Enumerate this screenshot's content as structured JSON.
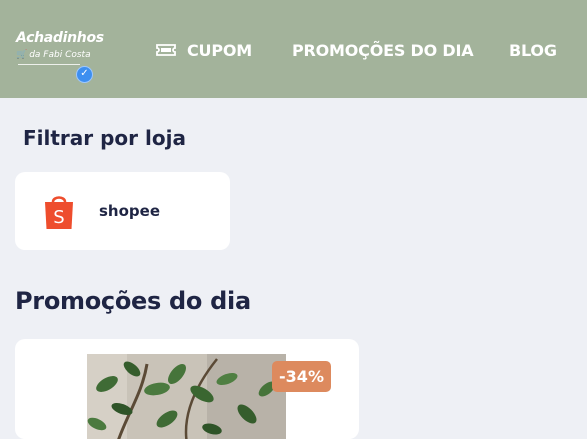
{
  "header": {
    "logo": {
      "line1": "Achadinhos",
      "line2": "da Fabi Costa",
      "cart_glyph": "🛒",
      "verified_icon": "verified-badge-icon",
      "verified_glyph": "✓"
    },
    "nav": {
      "cupom": {
        "icon": "ticket-icon",
        "label": "CUPOM"
      },
      "promocoes": {
        "label": "PROMOÇÕES DO DIA"
      },
      "blog": {
        "label": "BLOG"
      }
    },
    "background_color": "#a3b39b"
  },
  "filter": {
    "title": "Filtrar por loja",
    "stores": [
      {
        "name": "shopee",
        "icon": "shopee-bag-icon",
        "brand_color": "#ee4d2d"
      }
    ]
  },
  "promotions": {
    "title": "Promoções do dia",
    "products": [
      {
        "discount": "-34%",
        "image": "plant-photo",
        "badge_color": "#dd8a5e"
      }
    ]
  },
  "colors": {
    "page_background": "#eef0f5",
    "text_dark": "#1f2544",
    "card_background": "#ffffff"
  }
}
